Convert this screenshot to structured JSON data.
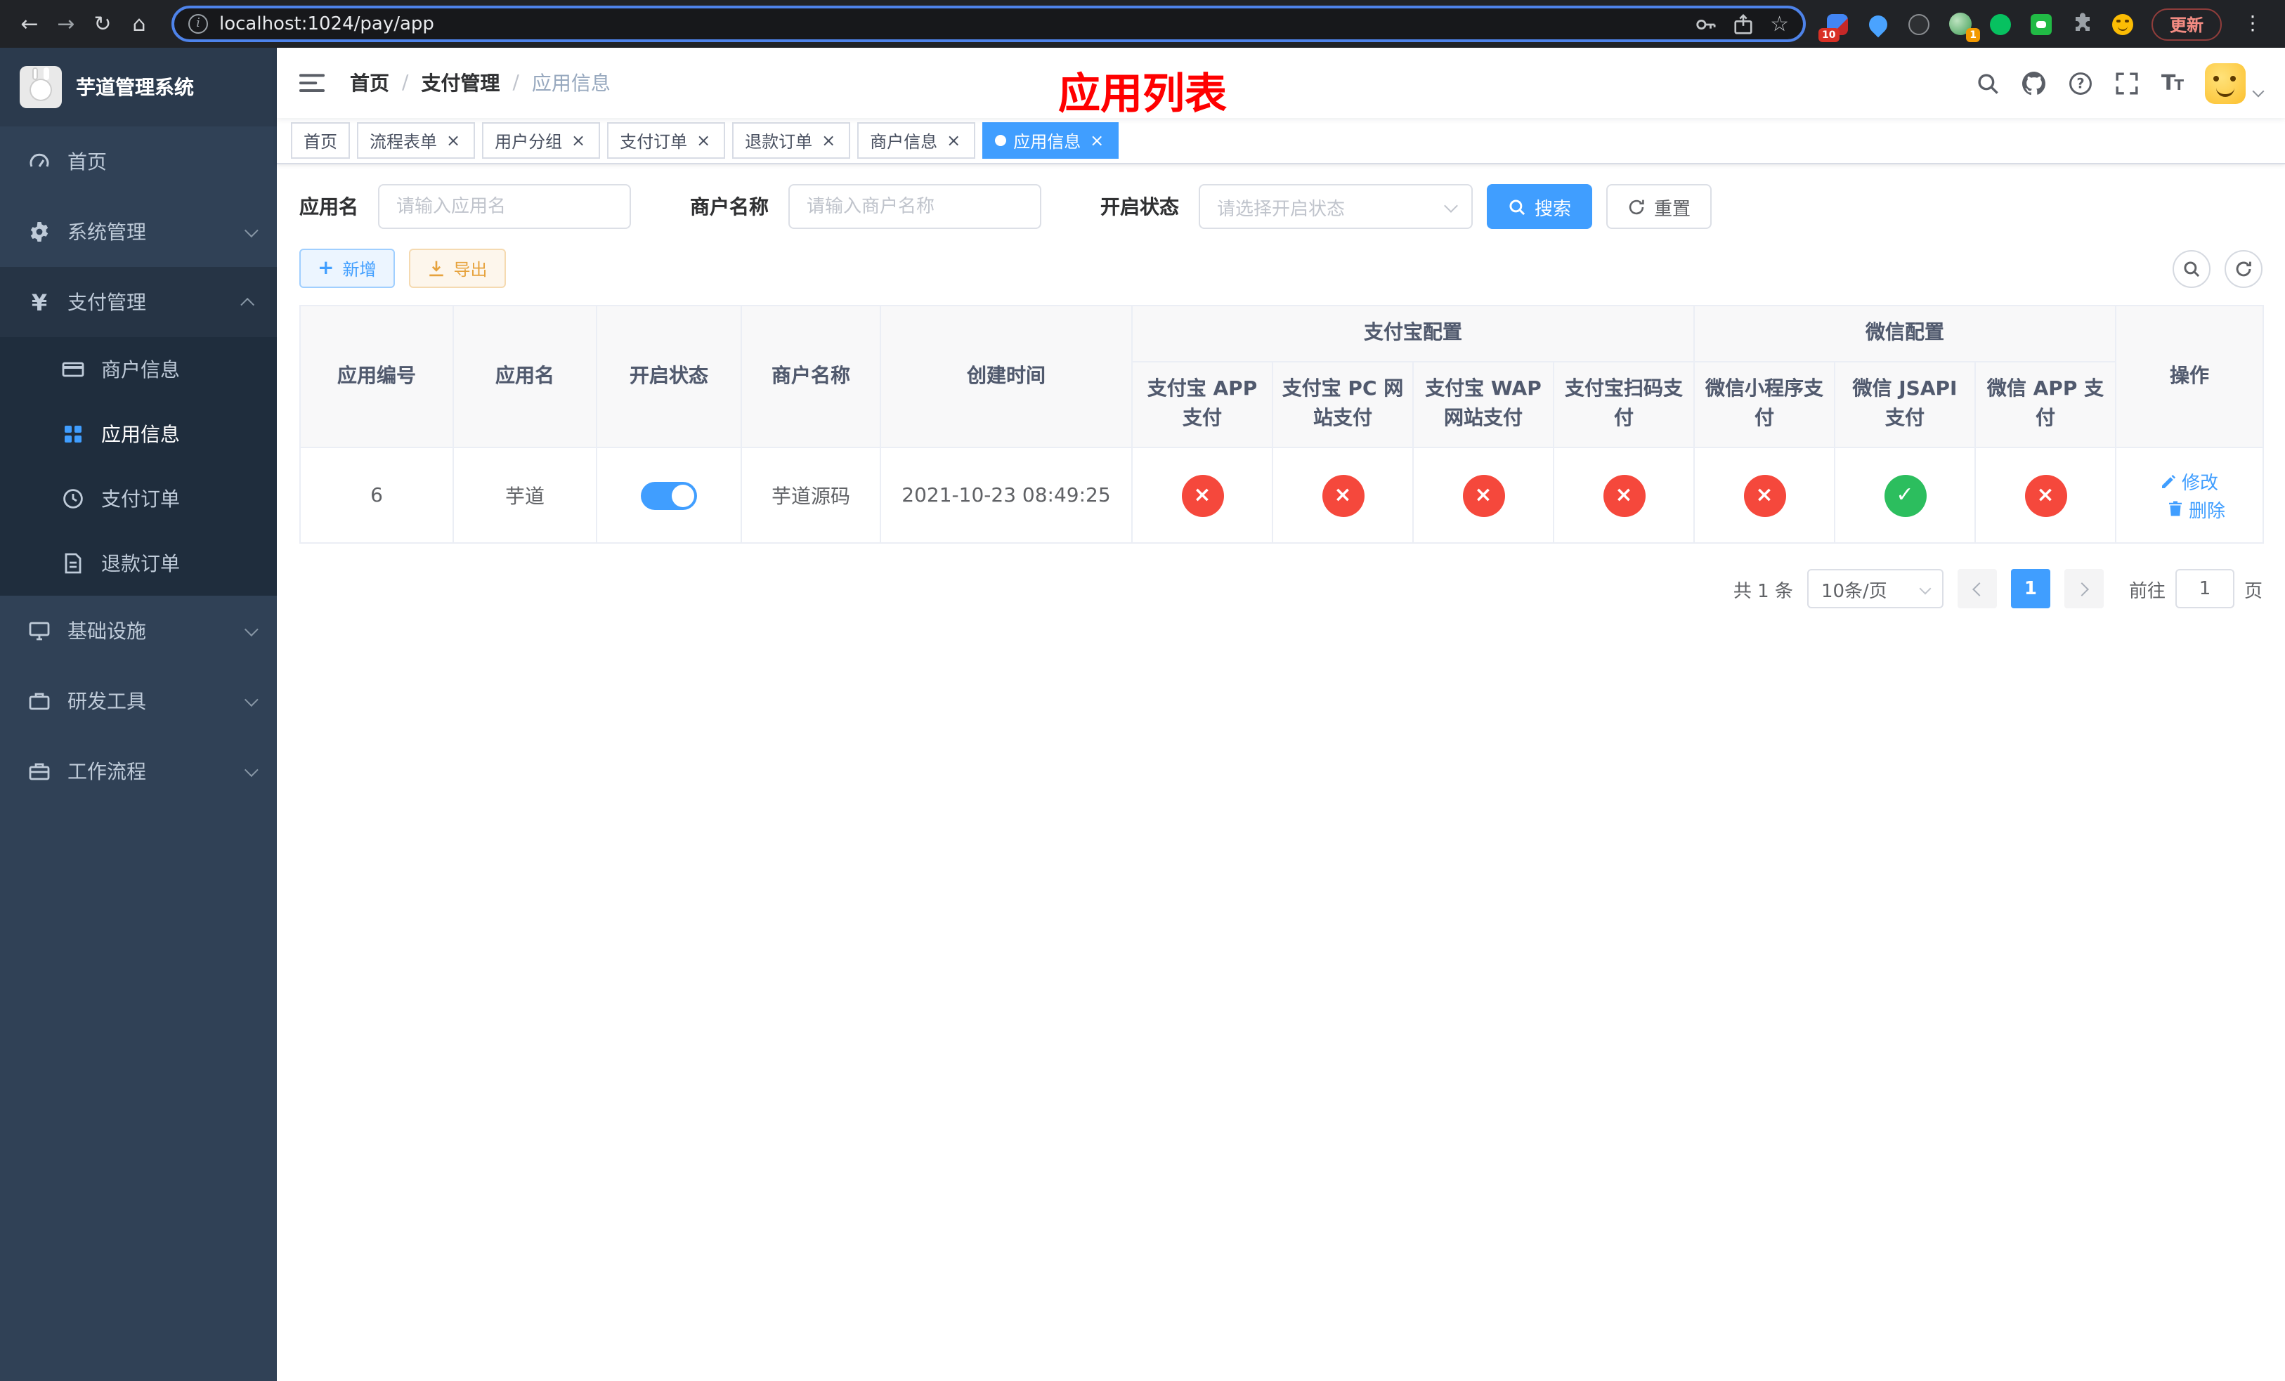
{
  "colors": {
    "primary": "#409eff",
    "success": "#2cbe5e",
    "danger": "#f5483c",
    "page_title_red": "#ff0000",
    "sidebar_bg": "#304156"
  },
  "browser": {
    "url": "localhost:1024/pay/app",
    "update_label": "更新",
    "ext_badges": {
      "notifications": "10",
      "avatar": "1"
    }
  },
  "sidebar": {
    "logo_title": "芋道管理系统",
    "items": [
      {
        "label": "首页"
      },
      {
        "label": "系统管理"
      },
      {
        "label": "支付管理"
      },
      {
        "label": "基础设施"
      },
      {
        "label": "研发工具"
      },
      {
        "label": "工作流程"
      }
    ],
    "payment_children": [
      {
        "label": "商户信息"
      },
      {
        "label": "应用信息"
      },
      {
        "label": "支付订单"
      },
      {
        "label": "退款订单"
      }
    ]
  },
  "header": {
    "breadcrumb": [
      {
        "label": "首页"
      },
      {
        "label": "支付管理"
      },
      {
        "label": "应用信息"
      }
    ],
    "page_title": "应用列表"
  },
  "tabs": [
    {
      "label": "首页",
      "closable": false,
      "active": false
    },
    {
      "label": "流程表单",
      "closable": true,
      "active": false
    },
    {
      "label": "用户分组",
      "closable": true,
      "active": false
    },
    {
      "label": "支付订单",
      "closable": true,
      "active": false
    },
    {
      "label": "退款订单",
      "closable": true,
      "active": false
    },
    {
      "label": "商户信息",
      "closable": true,
      "active": false
    },
    {
      "label": "应用信息",
      "closable": true,
      "active": true
    }
  ],
  "filters": {
    "app_name": {
      "label": "应用名",
      "placeholder": "请输入应用名",
      "value": ""
    },
    "merchant_name": {
      "label": "商户名称",
      "placeholder": "请输入商户名称",
      "value": ""
    },
    "status": {
      "label": "开启状态",
      "placeholder": "请选择开启状态"
    },
    "search_label": "搜索",
    "reset_label": "重置"
  },
  "toolbar": {
    "add_label": "新增",
    "export_label": "导出"
  },
  "table": {
    "headers": {
      "app_id": "应用编号",
      "app_name": "应用名",
      "status": "开启状态",
      "merchant_name": "商户名称",
      "create_time": "创建时间",
      "alipay_group": "支付宝配置",
      "wechat_group": "微信配置",
      "alipay_app": "支付宝 APP 支付",
      "alipay_pc": "支付宝 PC 网站支付",
      "alipay_wap": "支付宝 WAP 网站支付",
      "alipay_qr": "支付宝扫码支付",
      "wechat_lite": "微信小程序支付",
      "wechat_jsapi": "微信 JSAPI 支付",
      "wechat_app": "微信 APP 支付",
      "actions": "操作"
    },
    "rows": [
      {
        "app_id": "6",
        "app_name": "芋道",
        "status_on": true,
        "merchant_name": "芋道源码",
        "create_time": "2021-10-23 08:49:25",
        "configs": [
          false,
          false,
          false,
          false,
          false,
          true,
          false
        ],
        "edit_label": "修改",
        "delete_label": "删除"
      }
    ]
  },
  "pagination": {
    "total_text": "共 1 条",
    "page_size_text": "10条/页",
    "current_page": "1",
    "goto_prefix": "前往",
    "goto_value": "1",
    "goto_suffix": "页"
  }
}
